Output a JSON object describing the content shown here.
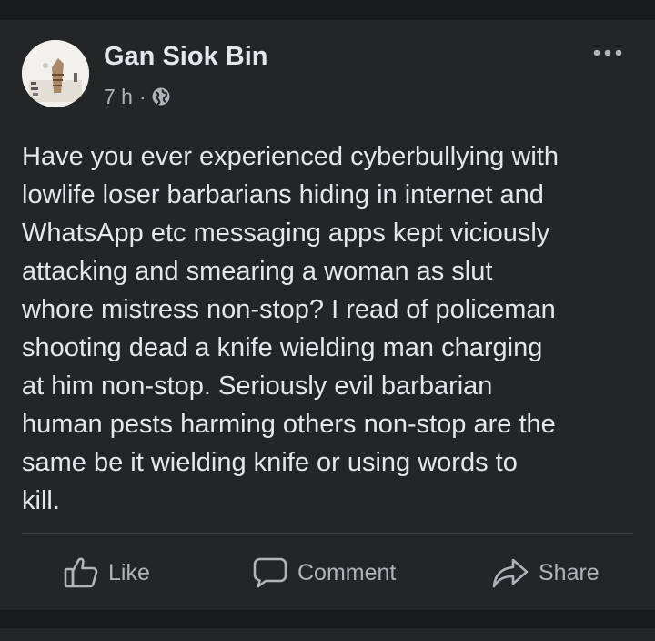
{
  "post": {
    "author": "Gan Siok Bin",
    "time": "7 h",
    "separator": "·",
    "audience_icon": "globe-icon",
    "more_icon": "more-options-icon",
    "text": "Have you ever experienced cyberbullying with\nlowlife loser barbarians hiding in internet and\nWhatsApp etc messaging apps kept viciously\nattacking and smearing a woman as slut\nwhore mistress non-stop? I read of policeman\nshooting dead a knife wielding man charging\nat him non-stop. Seriously evil barbarian\nhuman pests harming others non-stop are the\nsame be it wielding knife or using words to\nkill."
  },
  "actions": {
    "like_label": "Like",
    "comment_label": "Comment",
    "share_label": "Share"
  },
  "colors": {
    "page_background": "#18191a",
    "card_background": "#242526",
    "primary_text": "#e4e6eb",
    "secondary_text": "#b0b3b8",
    "divider": "#3e4042"
  }
}
